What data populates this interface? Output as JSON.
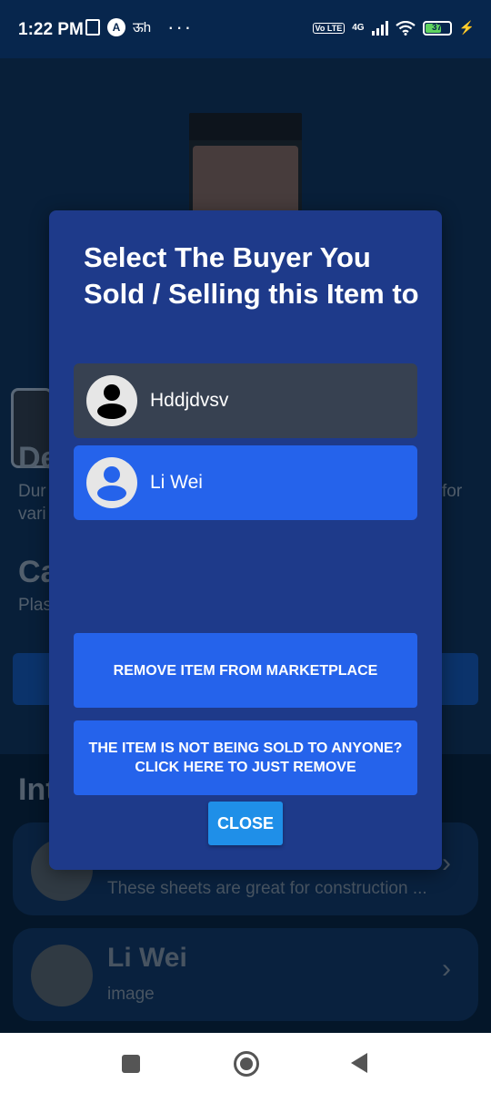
{
  "status_bar": {
    "time": "1:22 PM",
    "extra_glyph": "ऊh",
    "more": "···",
    "volte": "Vo LTE",
    "network": "4G",
    "battery": "37"
  },
  "background": {
    "heading_1": "De",
    "text_1a": "Dur",
    "text_1b": "vari",
    "text_1c": "for",
    "heading_2": "Ca",
    "text_2": "Plas",
    "section_heading": "Int",
    "cards": [
      {
        "title": "",
        "subtitle": "These sheets are great for construction ..."
      },
      {
        "title": "Li Wei",
        "subtitle": "image"
      }
    ],
    "chevron": "›"
  },
  "modal": {
    "title": "Select The Buyer You Sold / Selling this Item to",
    "buyers": [
      {
        "name": "Hddjdvsv",
        "color": "#374151"
      },
      {
        "name": "Li Wei",
        "color": "#2563eb"
      }
    ],
    "remove_button": "REMOVE ITEM FROM MARKETPLACE",
    "not_sold_button": "THE ITEM IS NOT BEING SOLD TO ANYONE? CLICK HERE TO JUST REMOVE",
    "close_button": "CLOSE"
  },
  "nav_bar": {
    "icons": [
      "recents-icon",
      "home-icon",
      "back-icon"
    ]
  }
}
